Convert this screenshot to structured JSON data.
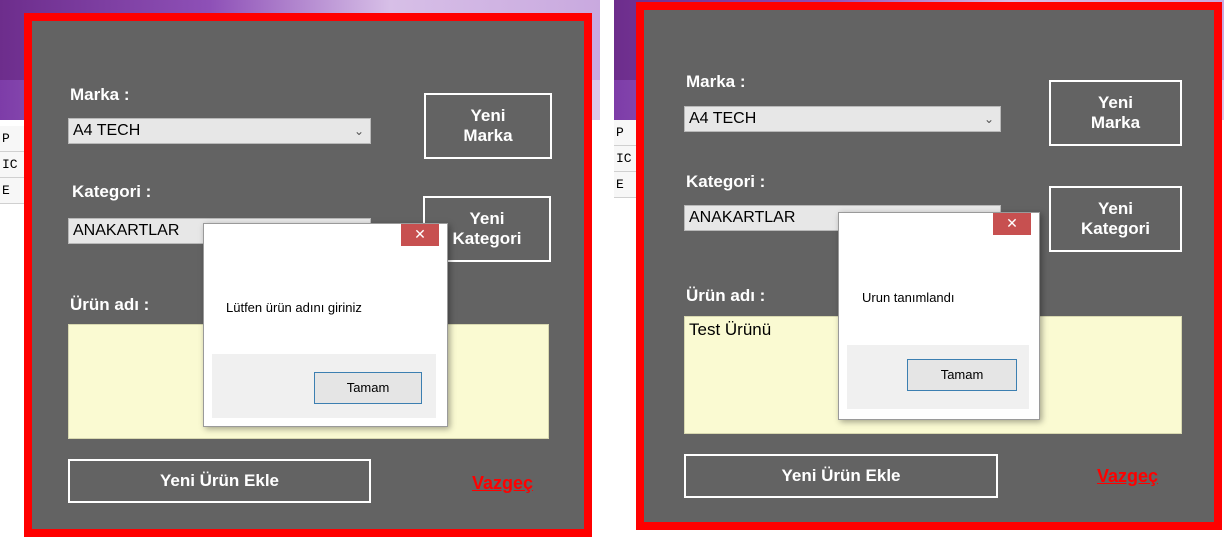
{
  "left": {
    "background_rows": [
      "P",
      "IC",
      "E"
    ],
    "marka_label": "Marka :",
    "marka_value": "A4 TECH",
    "yeni_marka_line1": "Yeni",
    "yeni_marka_line2": "Marka",
    "kategori_label": "Kategori :",
    "kategori_value": "ANAKARTLAR",
    "yeni_kategori_line1": "Yeni",
    "yeni_kategori_line2": "Kategori",
    "urun_label": "Ürün adı :",
    "urun_value": "",
    "add_button": "Yeni Ürün Ekle",
    "cancel_link": "Vazgeç",
    "dialog": {
      "close": "✕",
      "message": "Lütfen ürün adını giriniz",
      "ok": "Tamam"
    }
  },
  "right": {
    "background_rows": [
      "P",
      "IC",
      "E"
    ],
    "marka_label": "Marka :",
    "marka_value": "A4 TECH",
    "yeni_marka_line1": "Yeni",
    "yeni_marka_line2": "Marka",
    "kategori_label": "Kategori :",
    "kategori_value": "ANAKARTLAR",
    "yeni_kategori_line1": "Yeni",
    "yeni_kategori_line2": "Kategori",
    "urun_label": "Ürün adı :",
    "urun_value": "Test Ürünü",
    "add_button": "Yeni Ürün Ekle",
    "cancel_link": "Vazgeç",
    "dialog": {
      "close": "✕",
      "message": "Urun tanımlandı",
      "ok": "Tamam"
    }
  },
  "colors": {
    "frame_border": "#ff0000",
    "frame_fill": "#636363",
    "input_fill": "#fafad2",
    "cancel_link": "#ff0000",
    "dialog_close": "#c75050"
  }
}
